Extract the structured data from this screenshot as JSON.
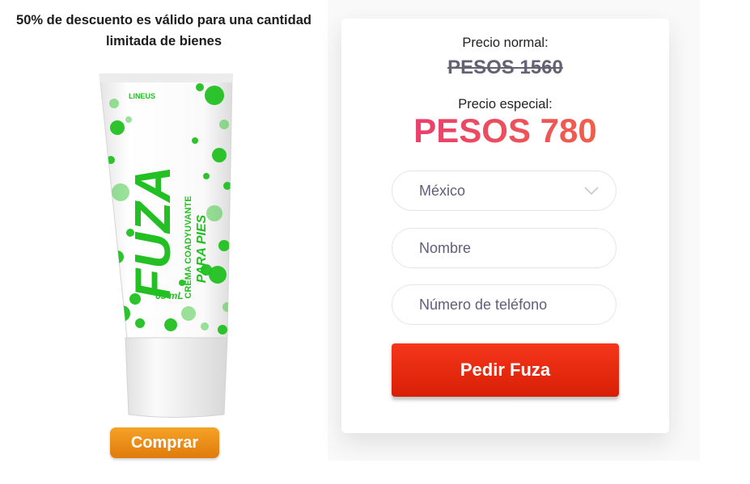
{
  "promo": {
    "text": "50% de descuento es válido para una cantidad limitada de bienes"
  },
  "product": {
    "brand": "LINEUS",
    "name": "FUZA",
    "subtitle": "CREMA COADYUVANTE",
    "subtitle2": "PARA PIES",
    "volume": "65 mL",
    "accent_color": "#22c022"
  },
  "buy_button": {
    "label": "Comprar",
    "color": "#ee8f18"
  },
  "pricing": {
    "normal_label": "Precio normal:",
    "normal_price": "PESOS 1560",
    "special_label": "Precio especial:",
    "special_price": "PESOS 780"
  },
  "form": {
    "country": {
      "value": "México",
      "icon": "chevron-down-icon"
    },
    "name": {
      "placeholder": "Nombre"
    },
    "phone": {
      "placeholder": "Número de teléfono"
    },
    "submit_label": "Pedir Fuza",
    "submit_color": "#e8280e"
  }
}
